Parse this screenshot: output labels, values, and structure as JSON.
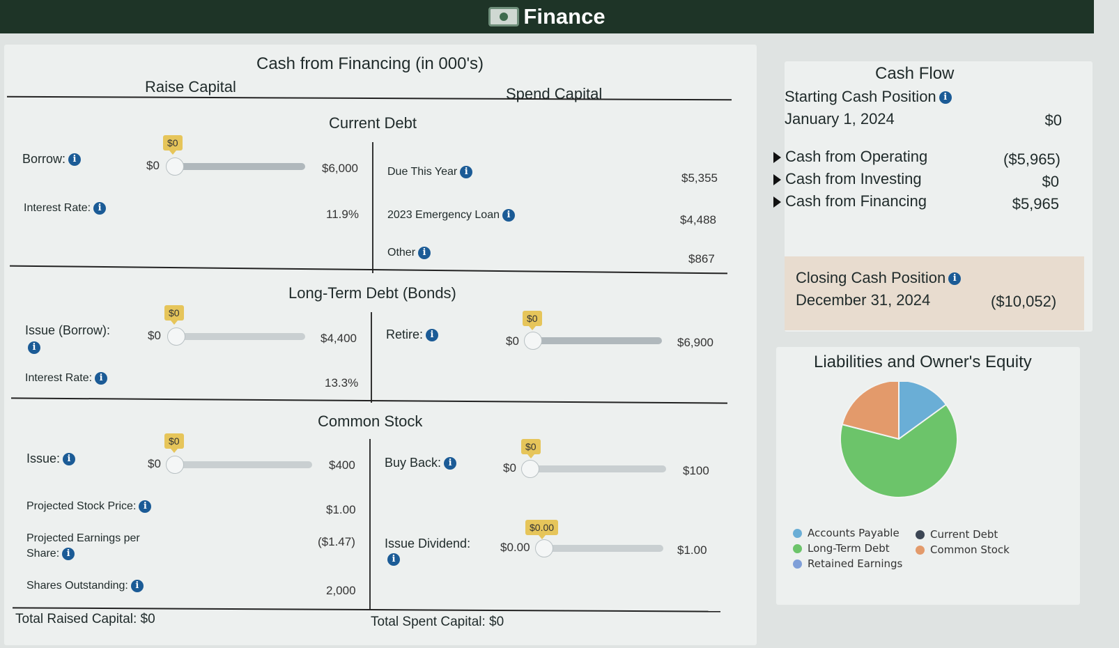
{
  "app": {
    "title": "Finance",
    "icon": "money-icon"
  },
  "financing": {
    "title": "Cash from Financing (in 000's)",
    "raise_title": "Raise Capital",
    "spend_title": "Spend Capital",
    "current_debt": {
      "title": "Current Debt",
      "borrow_label": "Borrow:",
      "borrow_bubble": "$0",
      "borrow_min": "$0",
      "borrow_max": "$6,000",
      "interest_label": "Interest Rate:",
      "interest_value": "11.9%",
      "due_label": "Due This Year",
      "due_value": "$5,355",
      "emergency_label": "2023 Emergency Loan",
      "emergency_value": "$4,488",
      "other_label": "Other",
      "other_value": "$867"
    },
    "long_term": {
      "title": "Long-Term Debt (Bonds)",
      "issue_label": "Issue (Borrow):",
      "issue_bubble": "$0",
      "issue_min": "$0",
      "issue_max": "$4,400",
      "interest_label": "Interest Rate:",
      "interest_value": "13.3%",
      "retire_label": "Retire:",
      "retire_bubble": "$0",
      "retire_min": "$0",
      "retire_max": "$6,900"
    },
    "common_stock": {
      "title": "Common Stock",
      "issue_label": "Issue:",
      "issue_bubble": "$0",
      "issue_min": "$0",
      "issue_max": "$400",
      "buyback_label": "Buy Back:",
      "buyback_bubble": "$0",
      "buyback_min": "$0",
      "buyback_max": "$100",
      "price_label": "Projected Stock Price:",
      "price_value": "$1.00",
      "eps_label_1": "Projected Earnings per",
      "eps_label_2": "Share:",
      "eps_value": "($1.47)",
      "dividend_label": "Issue Dividend:",
      "dividend_bubble": "$0.00",
      "dividend_min": "$0.00",
      "dividend_max": "$1.00",
      "shares_label": "Shares Outstanding:",
      "shares_value": "2,000"
    },
    "total_raised": "Total Raised Capital: $0",
    "total_spent": "Total Spent Capital: $0"
  },
  "cash_flow": {
    "title": "Cash Flow",
    "starting_label": "Starting Cash Position",
    "starting_date": "January 1, 2024",
    "starting_value": "$0",
    "rows": [
      {
        "label": "Cash from Operating",
        "value": "($5,965)"
      },
      {
        "label": "Cash from Investing",
        "value": "$0"
      },
      {
        "label": "Cash from Financing",
        "value": "$5,965"
      }
    ],
    "closing_label": "Closing Cash Position",
    "closing_date": "December 31, 2024",
    "closing_value": "($10,052)"
  },
  "liabilities": {
    "title": "Liabilities and Owner's Equity",
    "chart_data": {
      "type": "pie",
      "categories": [
        "Accounts Payable",
        "Current Debt",
        "Long-Term Debt",
        "Common Stock",
        "Retained Earnings"
      ],
      "values": [
        15,
        0,
        64,
        21,
        0
      ],
      "colors": [
        "#6aaed6",
        "#3c4654",
        "#6cc46a",
        "#e39a6b",
        "#7f9fd8"
      ],
      "legend_position": "bottom"
    },
    "legend": [
      {
        "label": "Accounts Payable",
        "color": "#6aaed6"
      },
      {
        "label": "Current Debt",
        "color": "#3c4654"
      },
      {
        "label": "Long-Term Debt",
        "color": "#6cc46a"
      },
      {
        "label": "Common Stock",
        "color": "#e39a6b"
      },
      {
        "label": "Retained Earnings",
        "color": "#7f9fd8"
      }
    ]
  }
}
